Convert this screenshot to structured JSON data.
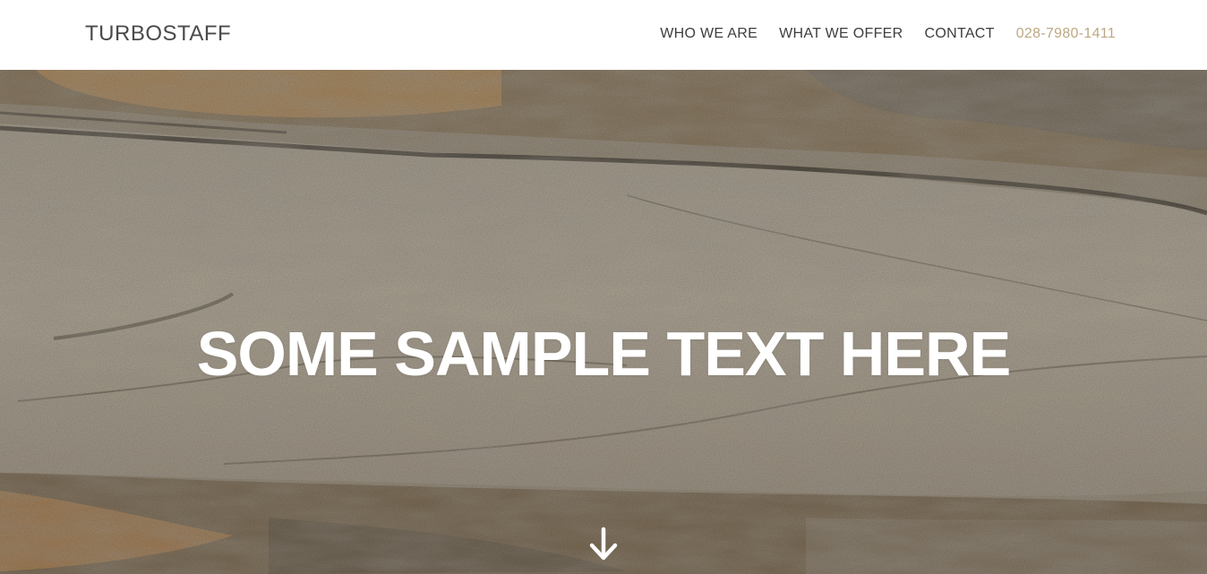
{
  "header": {
    "logo": "TURBOSTAFF",
    "nav": {
      "who_we_are": "WHO WE ARE",
      "what_we_offer": "WHAT WE OFFER",
      "contact": "CONTACT",
      "phone": "028-7980-1411"
    }
  },
  "hero": {
    "title": "SOME SAMPLE TEXT HERE",
    "scroll_icon": "arrow-down-icon",
    "background": "stone texture"
  },
  "colors": {
    "header_bg": "#ffffff",
    "nav_text": "#3d3d3d",
    "phone_accent": "#bda882",
    "hero_text": "#ffffff"
  }
}
